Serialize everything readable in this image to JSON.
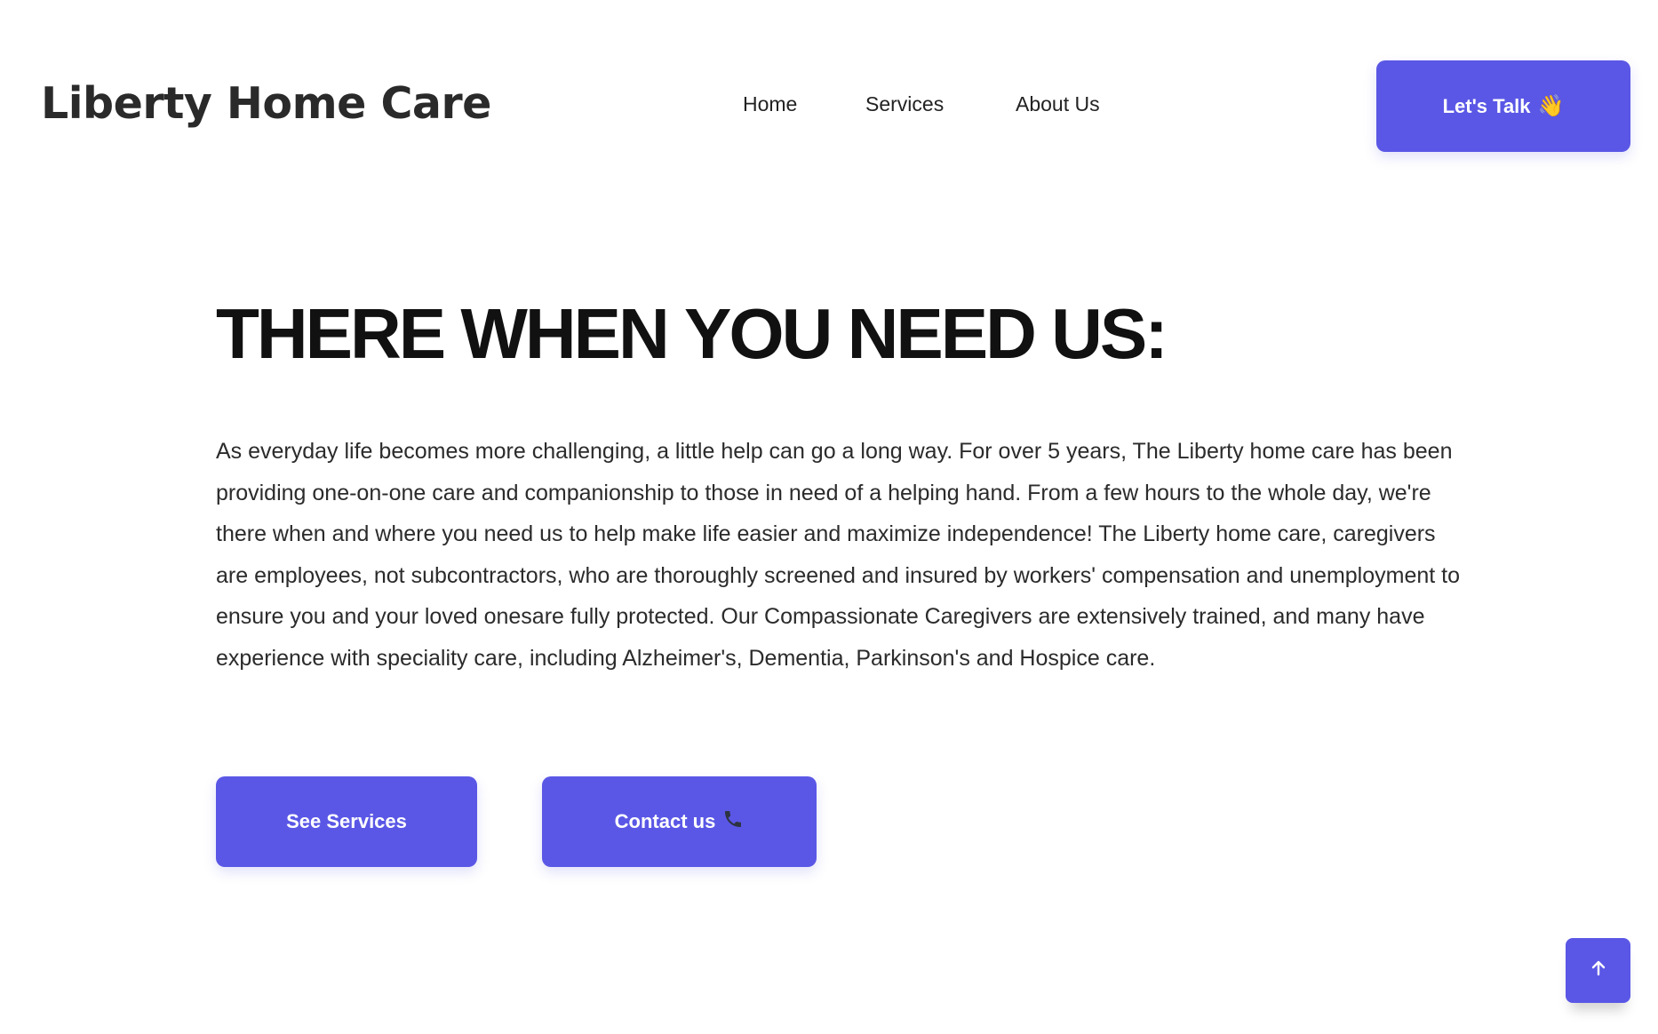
{
  "header": {
    "logo": "Liberty Home Care",
    "nav": {
      "home": "Home",
      "services": "Services",
      "about": "About Us"
    },
    "cta_label": "Let's Talk",
    "cta_icon": "waving-hand-icon"
  },
  "hero": {
    "title_plain": "THERE WHEN ",
    "title_highlight": "YOU NEED US:",
    "highlight_color": "#f6d65b",
    "body": "As everyday life becomes more challenging, a little help can go a long way. For over 5 years, The Liberty home care has been providing one-on-one care and companionship to those in need of a helping hand. From a few hours to the whole day, we're there when and where you need us to help make life easier and maximize independence! The Liberty home care, caregivers are employees, not subcontractors, who are thoroughly screened and insured by workers' compensation and unemployment to ensure you and your loved onesare fully protected. Our Compassionate Caregivers are extensively trained, and many have experience with speciality care, including Alzheimer's, Dementia, Parkinson's and Hospice care.",
    "services_button": "See Services",
    "contact_button": "Contact us",
    "contact_icon": "phone-icon"
  },
  "scroll_top_icon": "arrow-up-icon",
  "colors": {
    "accent": "#5a57e6",
    "text": "#1f1f1f"
  }
}
